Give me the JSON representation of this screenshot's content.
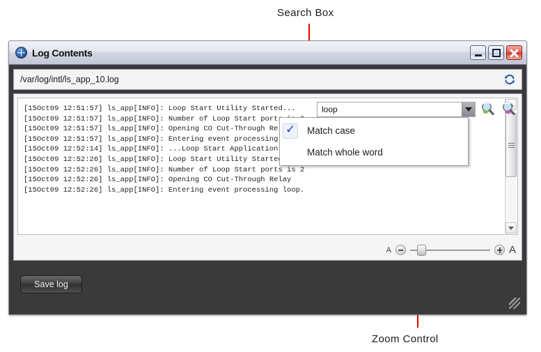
{
  "annotations": [
    {
      "id": "search-box",
      "label": "Search Box"
    },
    {
      "id": "zoom-control",
      "label": "Zoom Control"
    }
  ],
  "window": {
    "title": "Log Contents",
    "icon": "globe-icon",
    "controls": {
      "minimize": "Minimize",
      "maximize": "Maximize",
      "close": "Close"
    }
  },
  "path_bar": {
    "value": "/var/log/intl/ls_app_10.log",
    "refresh_icon": "refresh-icon"
  },
  "log": {
    "lines": [
      "[15Oct09 12:51:57] ls_app[INFO]: Loop Start Utility Started...",
      "[15Oct09 12:51:57] ls_app[INFO]: Number of Loop Start ports is 2",
      "[15Oct09 12:51:57] ls_app[INFO]: Opening CO Cut-Through Relay",
      "[15Oct09 12:51:57] ls_app[INFO]: Entering event processing loop.",
      "[15Oct09 12:52:14] ls_app[INFO]: ...Loop Start Application terminated.",
      "[15Oct09 12:52:26] ls_app[INFO]: Loop Start Utility Started...",
      "[15Oct09 12:52:26] ls_app[INFO]: Number of Loop Start ports is 2",
      "[15Oct09 12:52:26] ls_app[INFO]: Opening CO Cut-Through Relay",
      "[15Oct09 12:52:26] ls_app[INFO]: Entering event processing loop."
    ]
  },
  "search": {
    "value": "loop",
    "placeholder": "",
    "dropdown_arrow_icon": "chevron-down-icon",
    "find_previous_icon": "find-previous-icon",
    "find_next_icon": "find-next-icon",
    "menu": [
      {
        "label": "Match case",
        "checked": true
      },
      {
        "label": "Match whole word",
        "checked": false
      }
    ]
  },
  "zoom_control": {
    "small_a": "A",
    "large_a": "A",
    "minus_icon": "zoom-out-icon",
    "plus_icon": "zoom-in-icon",
    "slider_position_percent": 9
  },
  "footer": {
    "save_label": "Save log"
  },
  "colors": {
    "accent_red": "#e60000",
    "close_button": "#cf3c2c",
    "find_prev_arrow": "#7dc242",
    "find_next_arrow": "#d44bb0"
  }
}
